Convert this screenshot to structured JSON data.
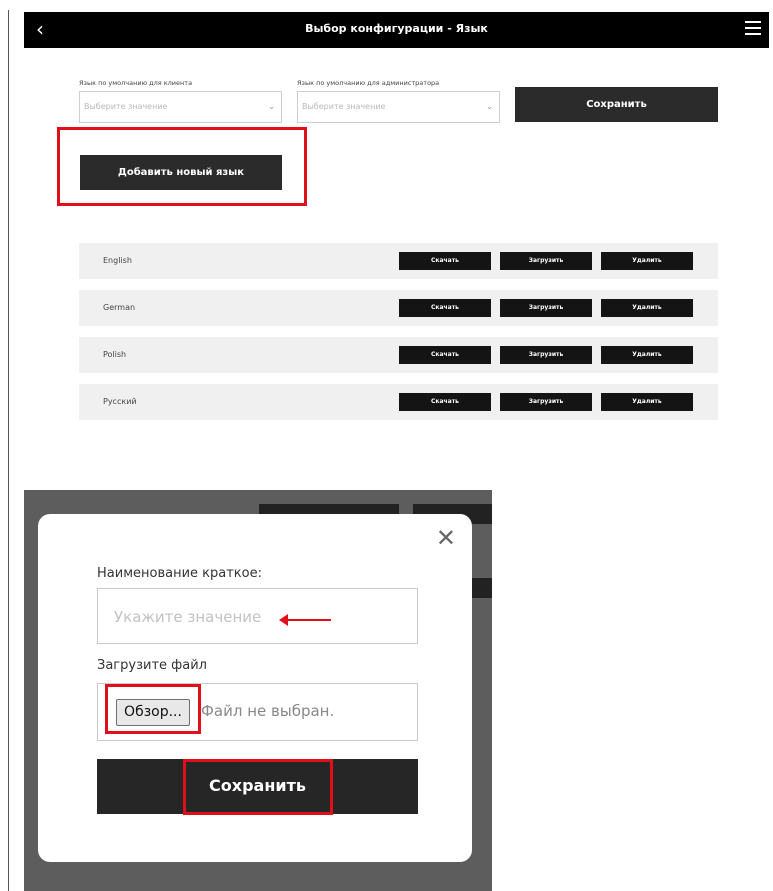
{
  "top": {
    "header": {
      "back_icon": "chevron-left-icon",
      "title": "Выбор конфигурации - Язык",
      "menu_icon": "hamburger-menu-icon"
    },
    "default_client_language": {
      "label": "Язык по умолчанию для клиента",
      "placeholder": "Выберите значение"
    },
    "default_admin_language": {
      "label": "Язык по умолчанию для администратора",
      "placeholder": "Выберите значение"
    },
    "save_label": "Сохранить",
    "add_language_label": "Добавить новый язык",
    "languages": [
      {
        "name": "English",
        "download": "Скачать",
        "upload": "Загрузить",
        "delete": "Удалить"
      },
      {
        "name": "German",
        "download": "Скачать",
        "upload": "Загрузить",
        "delete": "Удалить"
      },
      {
        "name": "Polish",
        "download": "Скачать",
        "upload": "Загрузить",
        "delete": "Удалить"
      },
      {
        "name": "Русский",
        "download": "Скачать",
        "upload": "Загрузить",
        "delete": "Удалить"
      }
    ]
  },
  "modal": {
    "close_icon": "close-icon",
    "short_name_label": "Наименование краткое:",
    "short_name_placeholder": "Укажите значение",
    "file_label": "Загрузите файл",
    "browse_label": "Обзор...",
    "file_status": "Файл не выбран.",
    "save_label": "Сохранить"
  },
  "colors": {
    "header_bg": "#000000",
    "button_bg": "#2b2b2b",
    "highlight": "#e0101a",
    "row_bg": "#f0f0f0"
  }
}
